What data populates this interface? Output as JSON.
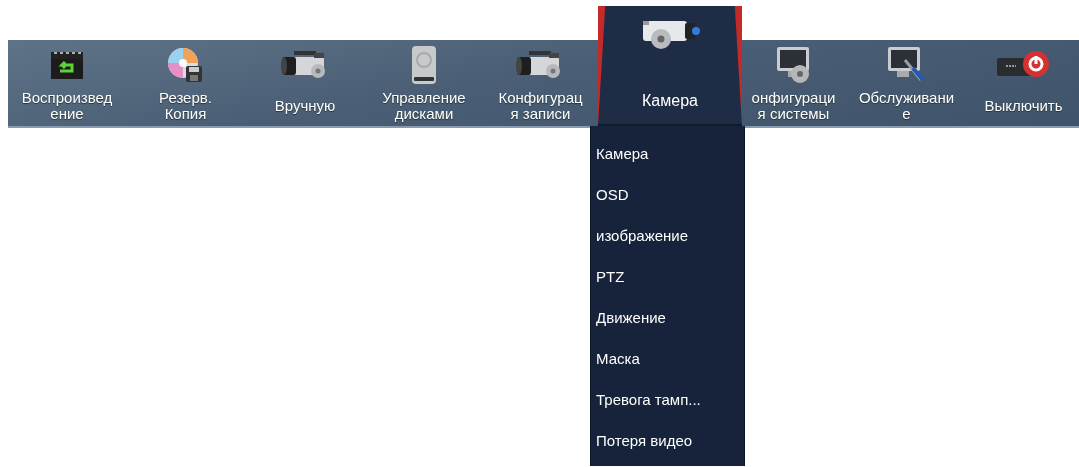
{
  "toolbar": {
    "items": [
      {
        "kind": "clapper",
        "lines": [
          "Воспроизвед",
          "ение"
        ],
        "selected": false
      },
      {
        "kind": "disc",
        "lines": [
          "Резерв.",
          "Копия"
        ],
        "selected": false
      },
      {
        "kind": "camcorder",
        "lines": [
          "Вручную"
        ],
        "selected": false
      },
      {
        "kind": "drive",
        "lines": [
          "Управление",
          "дисками"
        ],
        "selected": false
      },
      {
        "kind": "camcorder",
        "lines": [
          "Конфигурац",
          "я записи"
        ],
        "selected": false
      },
      {
        "kind": "camera",
        "lines": [
          "Камера"
        ],
        "selected": true
      },
      {
        "kind": "monitor",
        "lines": [
          "онфигураци",
          "я системы"
        ],
        "selected": false
      },
      {
        "kind": "tools",
        "lines": [
          "Обслуживани",
          "е"
        ],
        "selected": false
      },
      {
        "kind": "power",
        "lines": [
          "Выключить"
        ],
        "selected": false
      }
    ]
  },
  "submenu": {
    "items": [
      "Камера",
      "OSD",
      "изображение",
      "PTZ",
      "Движение",
      "Маска",
      "Тревога тамп...",
      "Потеря видео"
    ]
  }
}
